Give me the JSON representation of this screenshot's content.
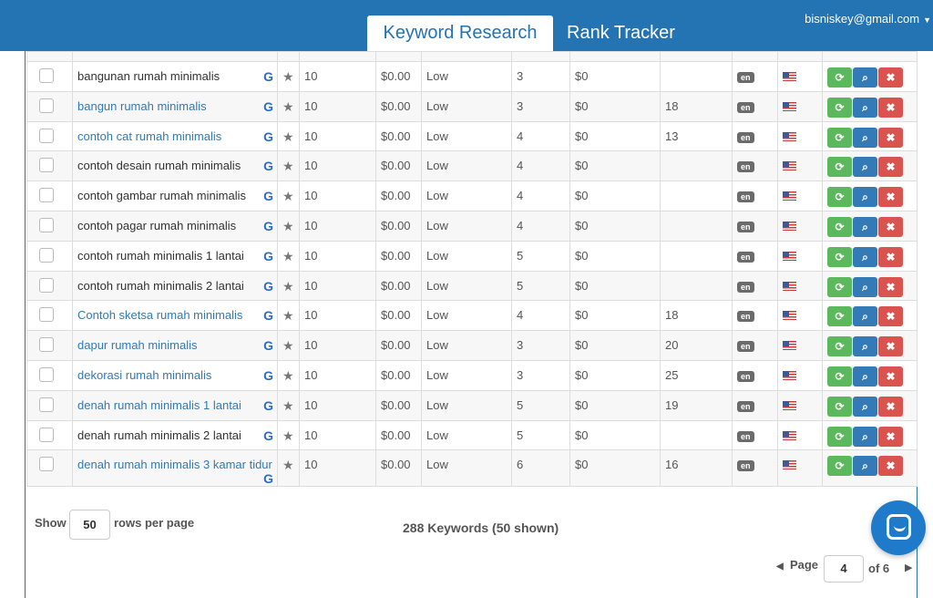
{
  "header": {
    "tabs": [
      {
        "label": "Keyword Research",
        "active": true
      },
      {
        "label": "Rank Tracker",
        "active": false
      }
    ],
    "user_email": "bisniskey@gmail.com",
    "accent_color": "#2473b3"
  },
  "table": {
    "rows": [
      {
        "keyword": "bangunan rumah minimalis",
        "link": false,
        "search_volume": "10",
        "cpc": "$0.00",
        "competition": "Low",
        "words": "3",
        "value": "$0",
        "rank": "",
        "lang": "en"
      },
      {
        "keyword": "bangun rumah minimalis",
        "link": true,
        "search_volume": "10",
        "cpc": "$0.00",
        "competition": "Low",
        "words": "3",
        "value": "$0",
        "rank": "18",
        "lang": "en"
      },
      {
        "keyword": "contoh cat rumah minimalis",
        "link": true,
        "search_volume": "10",
        "cpc": "$0.00",
        "competition": "Low",
        "words": "4",
        "value": "$0",
        "rank": "13",
        "lang": "en"
      },
      {
        "keyword": "contoh desain rumah minimalis",
        "link": false,
        "search_volume": "10",
        "cpc": "$0.00",
        "competition": "Low",
        "words": "4",
        "value": "$0",
        "rank": "",
        "lang": "en"
      },
      {
        "keyword": "contoh gambar rumah minimalis",
        "link": false,
        "search_volume": "10",
        "cpc": "$0.00",
        "competition": "Low",
        "words": "4",
        "value": "$0",
        "rank": "",
        "lang": "en"
      },
      {
        "keyword": "contoh pagar rumah minimalis",
        "link": false,
        "search_volume": "10",
        "cpc": "$0.00",
        "competition": "Low",
        "words": "4",
        "value": "$0",
        "rank": "",
        "lang": "en"
      },
      {
        "keyword": "contoh rumah minimalis 1 lantai",
        "link": false,
        "search_volume": "10",
        "cpc": "$0.00",
        "competition": "Low",
        "words": "5",
        "value": "$0",
        "rank": "",
        "lang": "en"
      },
      {
        "keyword": "contoh rumah minimalis 2 lantai",
        "link": false,
        "search_volume": "10",
        "cpc": "$0.00",
        "competition": "Low",
        "words": "5",
        "value": "$0",
        "rank": "",
        "lang": "en"
      },
      {
        "keyword": "Contoh sketsa rumah minimalis",
        "link": true,
        "search_volume": "10",
        "cpc": "$0.00",
        "competition": "Low",
        "words": "4",
        "value": "$0",
        "rank": "18",
        "lang": "en"
      },
      {
        "keyword": "dapur rumah minimalis",
        "link": true,
        "search_volume": "10",
        "cpc": "$0.00",
        "competition": "Low",
        "words": "3",
        "value": "$0",
        "rank": "20",
        "lang": "en"
      },
      {
        "keyword": "dekorasi rumah minimalis",
        "link": true,
        "search_volume": "10",
        "cpc": "$0.00",
        "competition": "Low",
        "words": "3",
        "value": "$0",
        "rank": "25",
        "lang": "en"
      },
      {
        "keyword": "denah rumah minimalis 1 lantai",
        "link": true,
        "search_volume": "10",
        "cpc": "$0.00",
        "competition": "Low",
        "words": "5",
        "value": "$0",
        "rank": "19",
        "lang": "en"
      },
      {
        "keyword": "denah rumah minimalis 2 lantai",
        "link": false,
        "search_volume": "10",
        "cpc": "$0.00",
        "competition": "Low",
        "words": "5",
        "value": "$0",
        "rank": "",
        "lang": "en"
      },
      {
        "keyword": "denah rumah minimalis 3 kamar tidur",
        "link": true,
        "search_volume": "10",
        "cpc": "$0.00",
        "competition": "Low",
        "words": "6",
        "value": "$0",
        "rank": "16",
        "lang": "en"
      }
    ],
    "google_glyph": "G",
    "star_glyph": "★",
    "refresh_glyph": "⟳",
    "search_glyph": "⌕",
    "delete_glyph": "✖"
  },
  "footer": {
    "show_label": "Show",
    "rows_per_page": "50",
    "rows_label": "rows per page",
    "count_text": "288 Keywords (50 shown)",
    "page_label": "Page",
    "page_value": "4",
    "of_label": "of 6",
    "prev_glyph": "◀",
    "next_glyph": "▶"
  },
  "colors": {
    "green": "#5cb85c",
    "blue": "#337ab7",
    "red": "#d9534f"
  }
}
